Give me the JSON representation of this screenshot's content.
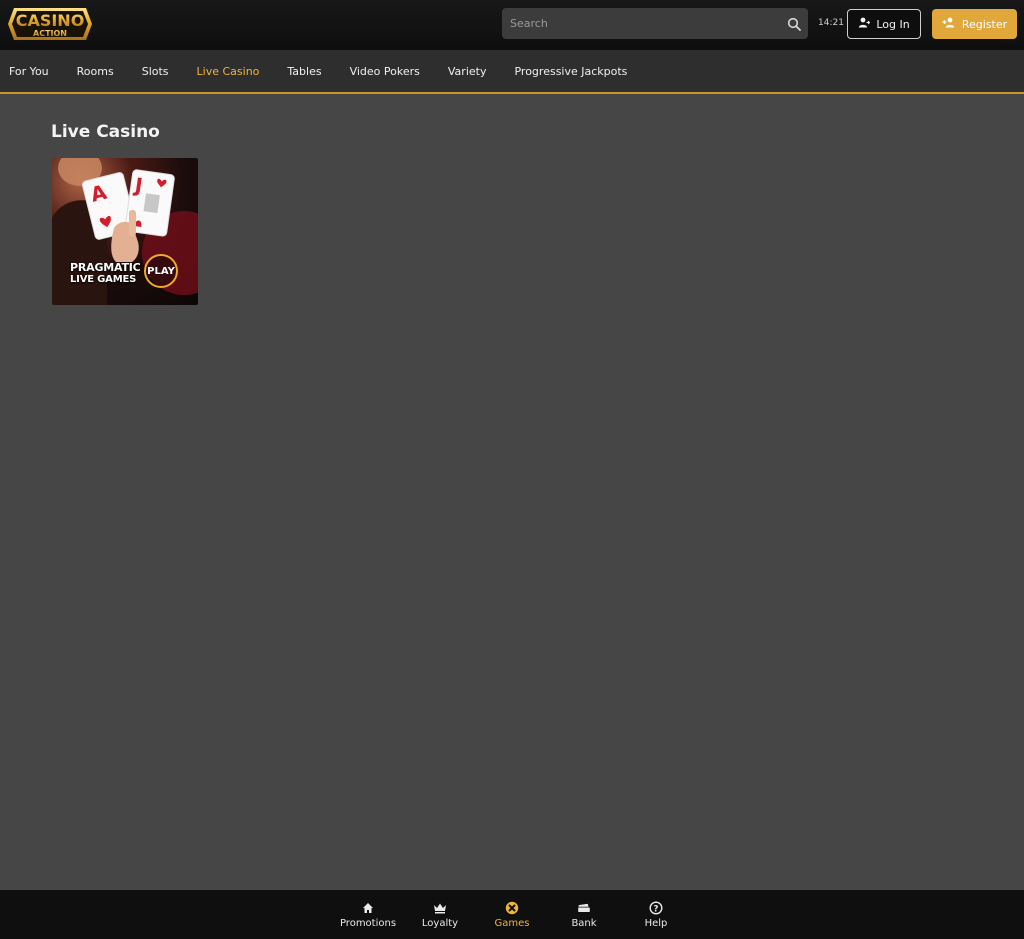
{
  "brand": {
    "logo_top": "CASINO",
    "logo_bottom": "ACTION",
    "accent": "#e2a73a",
    "nav_active_color": "#f0b43a"
  },
  "header": {
    "search_placeholder": "Search",
    "clock": "14:21",
    "login_label": "Log In",
    "register_label": "Register"
  },
  "nav": {
    "items": [
      {
        "label": "For You",
        "active": false
      },
      {
        "label": "Rooms",
        "active": false
      },
      {
        "label": "Slots",
        "active": false
      },
      {
        "label": "Live Casino",
        "active": true
      },
      {
        "label": "Tables",
        "active": false
      },
      {
        "label": "Video Pokers",
        "active": false
      },
      {
        "label": "Variety",
        "active": false
      },
      {
        "label": "Progressive Jackpots",
        "active": false
      }
    ]
  },
  "main": {
    "title": "Live Casino",
    "games": [
      {
        "brand_line1": "PRAGMATIC",
        "brand_line2": "LIVE GAMES",
        "badge": "PLAY",
        "card_a": "A",
        "card_j": "J"
      }
    ]
  },
  "bottom_nav": {
    "items": [
      {
        "label": "Promotions",
        "icon": "home-icon",
        "active": false
      },
      {
        "label": "Loyalty",
        "icon": "crown-icon",
        "active": false
      },
      {
        "label": "Games",
        "icon": "games-icon",
        "active": true
      },
      {
        "label": "Bank",
        "icon": "bank-icon",
        "active": false
      },
      {
        "label": "Help",
        "icon": "help-icon",
        "active": false
      }
    ]
  }
}
